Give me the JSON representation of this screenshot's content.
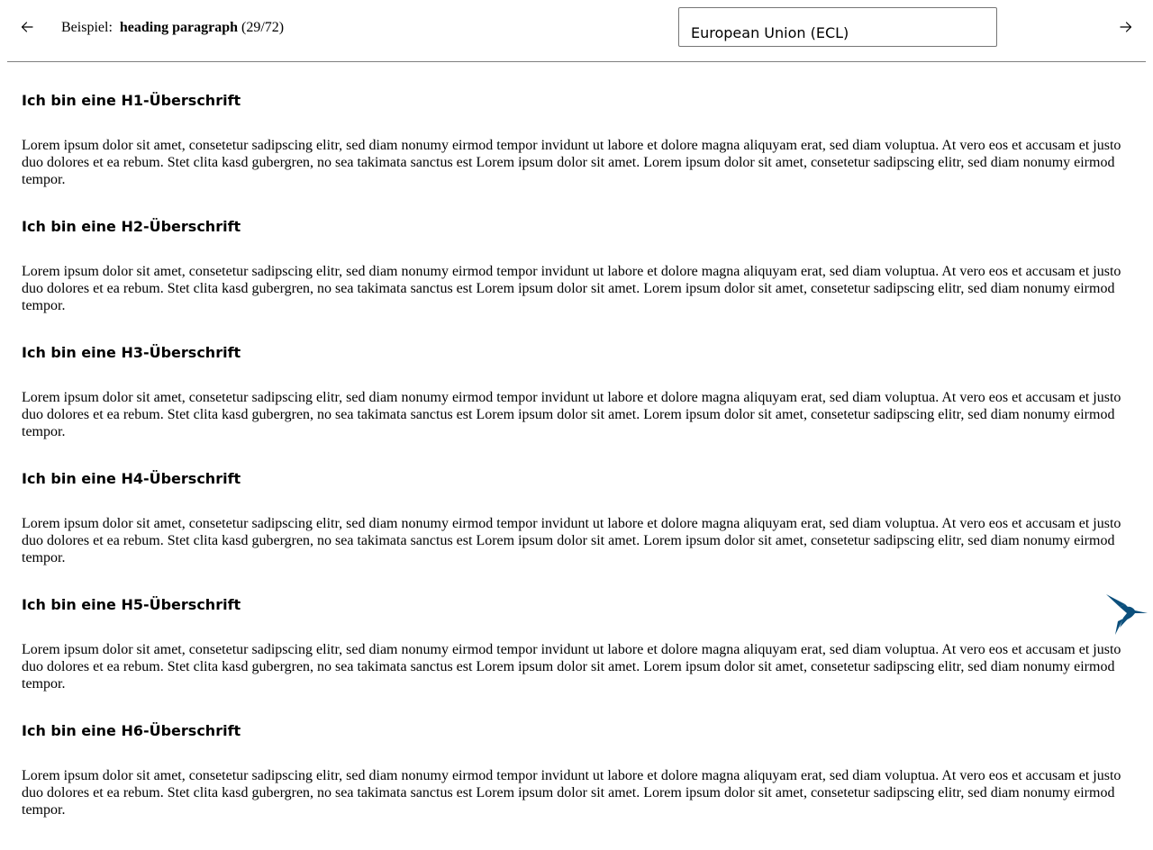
{
  "toolbar": {
    "prev_icon": "arrow-left-icon",
    "next_icon": "arrow-right-icon",
    "example_prefix": "Beispiel:",
    "example_name": "heading paragraph",
    "example_count": "(29/72)",
    "theme_value": "European Union (ECL)"
  },
  "main": {
    "sections": [
      {
        "heading": "Ich bin eine H1-Überschrift",
        "paragraph": "Lorem ipsum dolor sit amet, consetetur sadipscing elitr, sed diam nonumy eirmod tempor invidunt ut labore et dolore magna aliquyam erat, sed diam voluptua. At vero eos et accusam et justo duo dolores et ea rebum. Stet clita kasd gubergren, no sea takimata sanctus est Lorem ipsum dolor sit amet. Lorem ipsum dolor sit amet, consetetur sadipscing elitr, sed diam nonumy eirmod tempor."
      },
      {
        "heading": "Ich bin eine H2-Überschrift",
        "paragraph": "Lorem ipsum dolor sit amet, consetetur sadipscing elitr, sed diam nonumy eirmod tempor invidunt ut labore et dolore magna aliquyam erat, sed diam voluptua. At vero eos et accusam et justo duo dolores et ea rebum. Stet clita kasd gubergren, no sea takimata sanctus est Lorem ipsum dolor sit amet. Lorem ipsum dolor sit amet, consetetur sadipscing elitr, sed diam nonumy eirmod tempor."
      },
      {
        "heading": "Ich bin eine H3-Überschrift",
        "paragraph": "Lorem ipsum dolor sit amet, consetetur sadipscing elitr, sed diam nonumy eirmod tempor invidunt ut labore et dolore magna aliquyam erat, sed diam voluptua. At vero eos et accusam et justo duo dolores et ea rebum. Stet clita kasd gubergren, no sea takimata sanctus est Lorem ipsum dolor sit amet. Lorem ipsum dolor sit amet, consetetur sadipscing elitr, sed diam nonumy eirmod tempor."
      },
      {
        "heading": "Ich bin eine H4-Überschrift",
        "paragraph": "Lorem ipsum dolor sit amet, consetetur sadipscing elitr, sed diam nonumy eirmod tempor invidunt ut labore et dolore magna aliquyam erat, sed diam voluptua. At vero eos et accusam et justo duo dolores et ea rebum. Stet clita kasd gubergren, no sea takimata sanctus est Lorem ipsum dolor sit amet. Lorem ipsum dolor sit amet, consetetur sadipscing elitr, sed diam nonumy eirmod tempor."
      },
      {
        "heading": "Ich bin eine H5-Überschrift",
        "paragraph": "Lorem ipsum dolor sit amet, consetetur sadipscing elitr, sed diam nonumy eirmod tempor invidunt ut labore et dolore magna aliquyam erat, sed diam voluptua. At vero eos et accusam et justo duo dolores et ea rebum. Stet clita kasd gubergren, no sea takimata sanctus est Lorem ipsum dolor sit amet. Lorem ipsum dolor sit amet, consetetur sadipscing elitr, sed diam nonumy eirmod tempor."
      },
      {
        "heading": "Ich bin eine H6-Überschrift",
        "paragraph": "Lorem ipsum dolor sit amet, consetetur sadipscing elitr, sed diam nonumy eirmod tempor invidunt ut labore et dolore magna aliquyam erat, sed diam voluptua. At vero eos et accusam et justo duo dolores et ea rebum. Stet clita kasd gubergren, no sea takimata sanctus est Lorem ipsum dolor sit amet. Lorem ipsum dolor sit amet, consetetur sadipscing elitr, sed diam nonumy eirmod tempor."
      }
    ]
  },
  "logo": {
    "icon": "hummingbird-icon",
    "color": "#0b4f7c"
  }
}
